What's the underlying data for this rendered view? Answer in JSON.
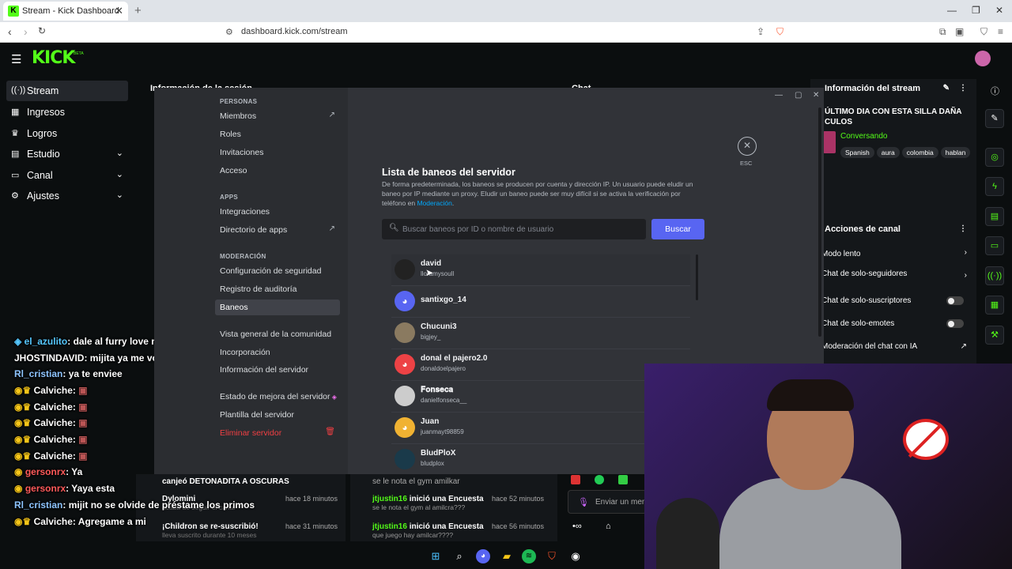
{
  "browser": {
    "tab_title": "Stream - Kick Dashboard",
    "url": "dashboard.kick.com/stream"
  },
  "kick": {
    "logo": "KICK",
    "beta": "BETA",
    "sidebar": [
      {
        "label": "Stream",
        "icon": "stream-icon",
        "active": true
      },
      {
        "label": "Ingresos",
        "icon": "money-icon"
      },
      {
        "label": "Logros",
        "icon": "trophy-icon"
      },
      {
        "label": "Estudio",
        "icon": "studio-icon",
        "expand": true
      },
      {
        "label": "Canal",
        "icon": "channel-icon",
        "expand": true
      },
      {
        "label": "Ajustes",
        "icon": "gear-icon",
        "expand": true
      }
    ],
    "session_panel_title": "Información de la sesión",
    "chat_panel_title": "Chat",
    "stream_info": {
      "title": "Información del stream",
      "stream_title": "ÚLTIMO DIA CON ESTA SILLA DAÑA CULOS",
      "category": "Conversando",
      "tags": [
        "Spanish",
        "aura",
        "colombia",
        "hablan"
      ]
    },
    "channel_actions": {
      "title": "Acciones de canal",
      "items": [
        "Modo lento",
        "Chat de solo-seguidores",
        "Chat de solo-suscriptores",
        "Chat de solo-emotes",
        "Moderación del chat con IA"
      ]
    },
    "activity": [
      {
        "text": "canjeó DETONADITA A OSCURAS",
        "time": ""
      },
      {
        "user": "Dylomini",
        "sub": "acaba de seguir el canal",
        "time": "hace 18 minutos"
      },
      {
        "user": "¡Childron se re-suscribió!",
        "sub": "lleva suscrito durante 10 meses",
        "time": "hace 31 minutos"
      }
    ],
    "chat_feed": [
      {
        "text": "se le nota el gym amilkar",
        "time": ""
      },
      {
        "user": "jtjustin16",
        "action": "inició una Encuesta",
        "sub": "se le nota el gym al amilcra???",
        "time": "hace 52 minutos"
      },
      {
        "user": "jtjustin16",
        "action": "inició una Encuesta",
        "sub": "que juego hay amilcar????",
        "time": "hace 56 minutos"
      }
    ],
    "chat_input_placeholder": "Enviar un mensaje"
  },
  "overlay_chat": [
    {
      "user": "el_azulito",
      "msg": ": dale al furry love mijit",
      "color": "#56c8ff"
    },
    {
      "user": "JHOSTINDAVID",
      "msg": ": mijita ya me voy a dormir agamos eso ya",
      "color": "#ffffff"
    },
    {
      "user": "Rl_cristian",
      "msg": ": ya te enviee",
      "color": "#8ec5ff"
    },
    {
      "user": "Calviche",
      "msg": ":",
      "color": "#ffffff"
    },
    {
      "user": "Calviche",
      "msg": ":",
      "color": "#ffffff"
    },
    {
      "user": "Calviche",
      "msg": ":",
      "color": "#ffffff"
    },
    {
      "user": "Calviche",
      "msg": ":",
      "color": "#ffffff"
    },
    {
      "user": "Calviche",
      "msg": ":",
      "color": "#ffffff"
    },
    {
      "user": "gersonrx",
      "msg": ": Ya",
      "color": "#ff5a5a"
    },
    {
      "user": "gersonrx",
      "msg": ": Yaya esta",
      "color": "#ff5a5a"
    },
    {
      "user": "Rl_cristian",
      "msg": ": mijit no se olvide de préstame los primos",
      "color": "#8ec5ff"
    },
    {
      "user": "Calviche",
      "msg": ": Agregame a mi",
      "color": "#ffffff"
    }
  ],
  "discord": {
    "sections": [
      {
        "header": "PERSONAS",
        "items": [
          {
            "label": "Miembros",
            "ext": true
          },
          {
            "label": "Roles"
          },
          {
            "label": "Invitaciones"
          },
          {
            "label": "Acceso"
          }
        ]
      },
      {
        "header": "APPS",
        "items": [
          {
            "label": "Integraciones"
          },
          {
            "label": "Directorio de apps",
            "ext": true
          }
        ]
      },
      {
        "header": "MODERACIÓN",
        "items": [
          {
            "label": "Configuración de seguridad"
          },
          {
            "label": "Registro de auditoría"
          },
          {
            "label": "Baneos",
            "active": true
          },
          {
            "label": "Vista general de la comunidad"
          },
          {
            "label": "Incorporación"
          },
          {
            "label": "Información del servidor"
          }
        ]
      }
    ],
    "extra_items": [
      "Estado de mejora del servidor",
      "Plantilla del servidor"
    ],
    "delete_label": "Eliminar servidor",
    "title": "Lista de baneos del servidor",
    "description": "De forma predeterminada, los baneos se producen por cuenta y dirección IP. Un usuario puede eludir un baneo por IP mediante un proxy. Eludir un baneo puede ser muy difícil si se activa la verificación por teléfono en",
    "description_link": "Moderación",
    "search_placeholder": "Buscar baneos por ID o nombre de usuario",
    "search_button": "Buscar",
    "esc_label": "ESC",
    "bans": [
      {
        "name": "david",
        "username": "lloramysoull",
        "avatar_color": "#222"
      },
      {
        "name": "santixgo_14",
        "username": "",
        "avatar_color": "#5865f2"
      },
      {
        "name": "Chucuni3",
        "username": "bigjey_",
        "avatar_color": "#8a7a60"
      },
      {
        "name": "donal el pajero2.0",
        "username": "donaldoelpajero",
        "avatar_color": "#ed4245"
      },
      {
        "name": "𝐅𝐨𝐧𝐬𝐞𝐜𝐚",
        "username": "danielfonseca__",
        "avatar_color": "#ccc"
      },
      {
        "name": "Juan",
        "username": "juanmayt98859",
        "avatar_color": "#f0b232"
      },
      {
        "name": "BludPloX",
        "username": "bludplox",
        "avatar_color": "#1a3a4a"
      }
    ]
  }
}
